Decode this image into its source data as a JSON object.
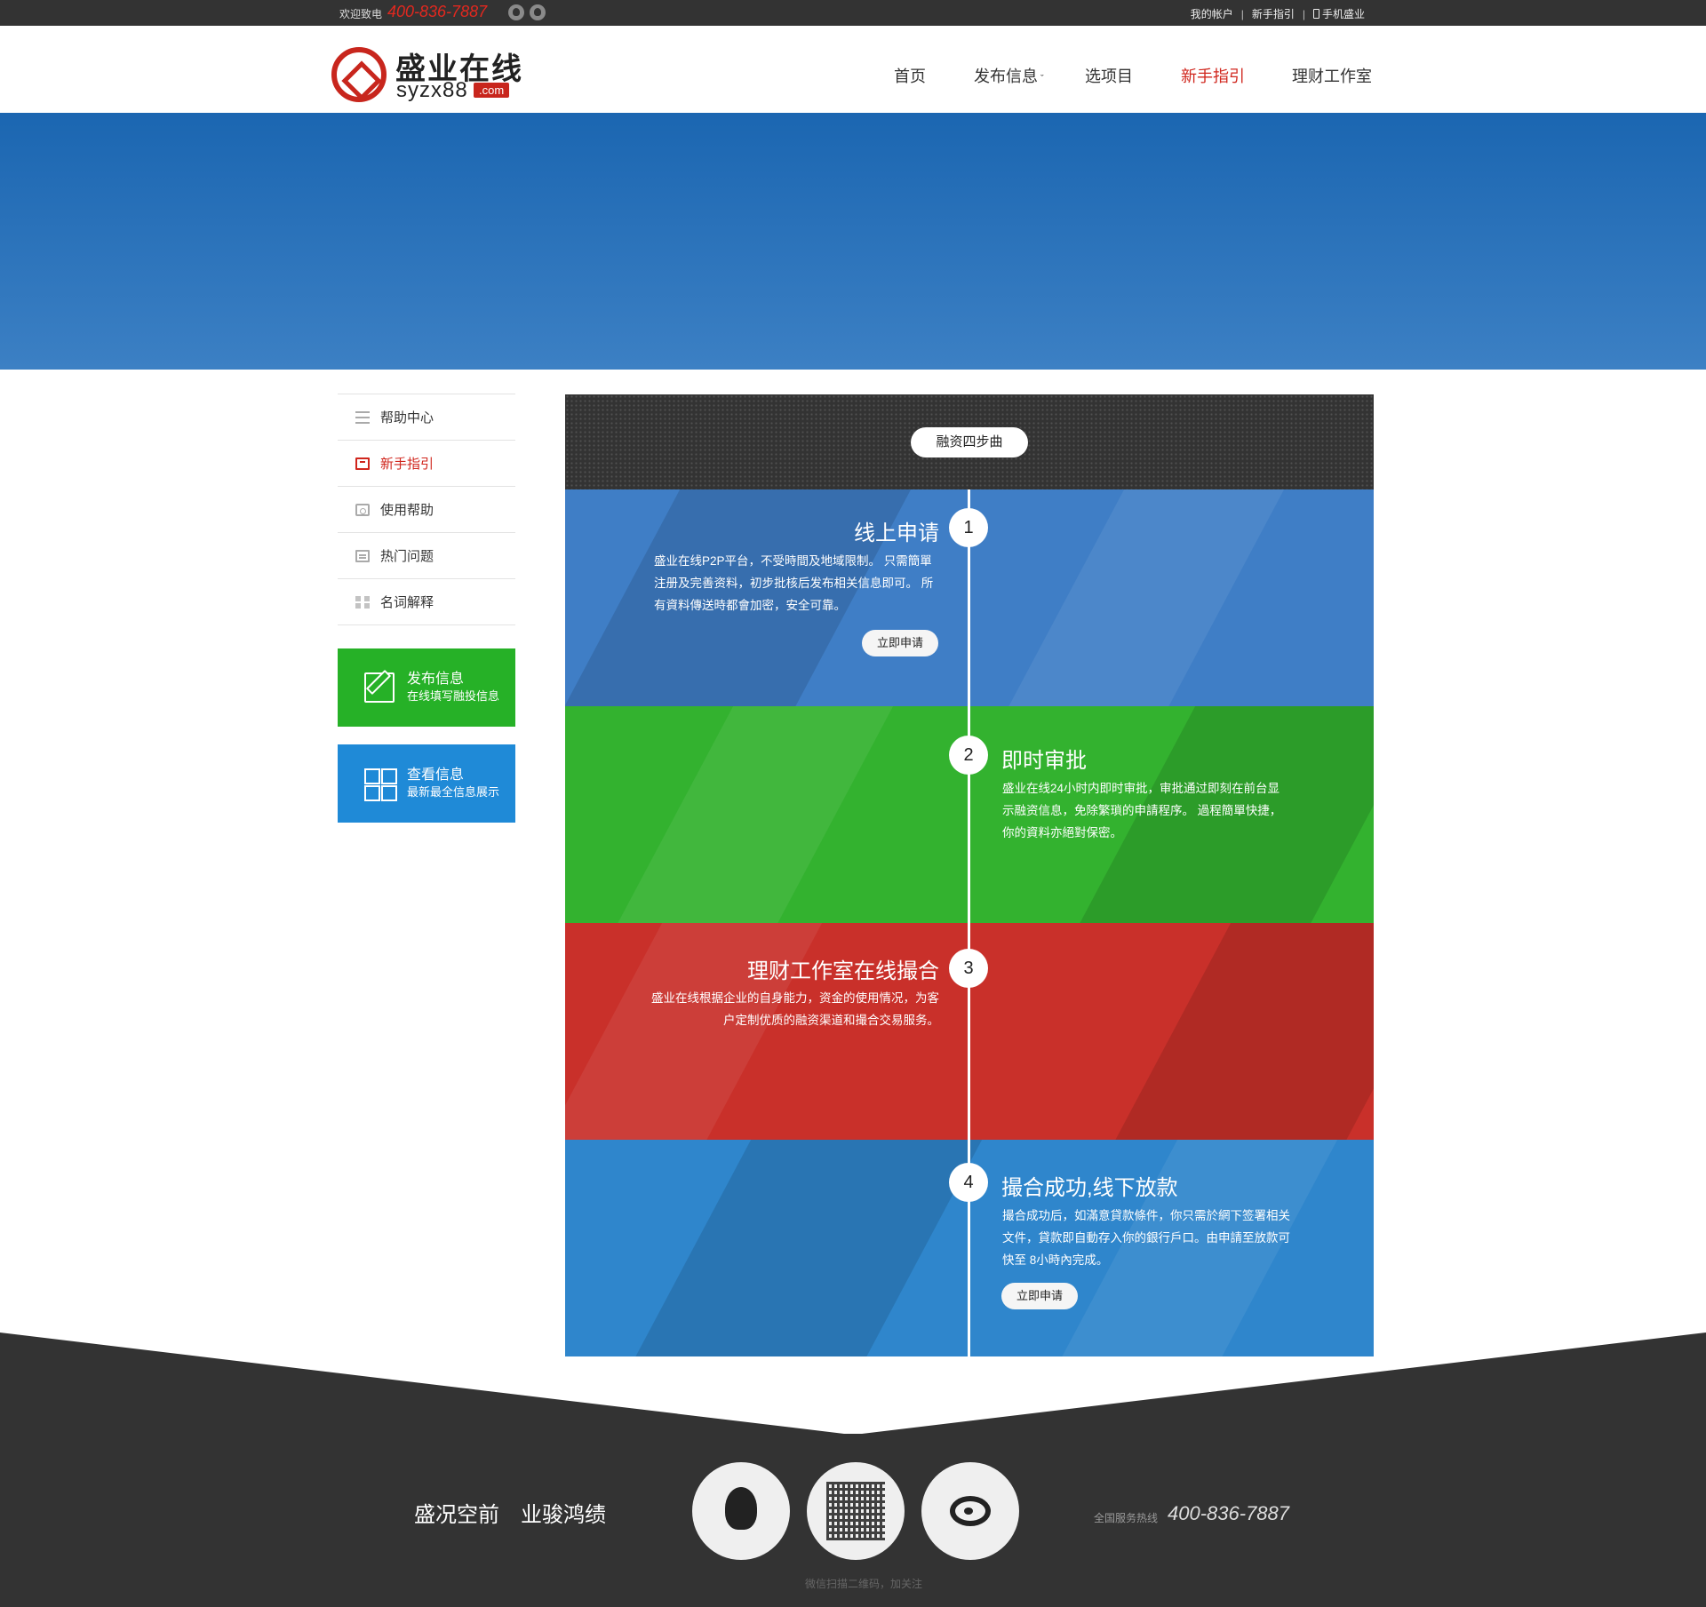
{
  "topbar": {
    "welcome": "欢迎致电",
    "phone": "400-836-7887",
    "icons": [
      "wechat-icon",
      "qq-icon"
    ],
    "links": [
      "我的帐户",
      "新手指引",
      "手机盛业"
    ],
    "separator": "|"
  },
  "header": {
    "logo_cn": "盛业在线",
    "logo_en": "syzx88",
    "logo_com": ".com",
    "nav": [
      "首页",
      "发布信息",
      "选项目",
      "新手指引",
      "理财工作室"
    ],
    "nav_active": "新手指引",
    "chevron": "ˇ"
  },
  "sidebar": {
    "items": [
      {
        "label": "帮助中心",
        "icon": "menu-icon"
      },
      {
        "label": "新手指引",
        "icon": "guide-icon",
        "active": true
      },
      {
        "label": "使用帮助",
        "icon": "help-icon"
      },
      {
        "label": "热门问题",
        "icon": "faq-icon"
      },
      {
        "label": "名词解释",
        "icon": "glossary-icon"
      }
    ],
    "publish": {
      "title": "发布信息",
      "subtitle": "在线填写融投信息",
      "icon": "pen-icon"
    },
    "view": {
      "title": "查看信息",
      "subtitle": "最新最全信息展示",
      "icon": "grid-icon"
    }
  },
  "panel": {
    "title": "融资四步曲",
    "steps": [
      {
        "num": "1",
        "title": "线上申请",
        "desc": [
          "盛业在线P2P平台，不受時間及地域限制。 只需簡單",
          "注册及完善资料，初步批核后发布相关信息即可。 所",
          "有資料傳送時都會加密，安全可靠。"
        ],
        "button": "立即申请"
      },
      {
        "num": "2",
        "title": "即时审批",
        "desc": [
          "盛业在线24小时内即时审批，审批通过即刻在前台显",
          "示融资信息，免除繁瑣的申請程序。 過程簡單快捷，",
          "你的資料亦絕對保密。"
        ]
      },
      {
        "num": "3",
        "title": "理财工作室在线撮合",
        "desc": [
          "盛业在线根据企业的自身能力，资金的使用情况，为客",
          "户定制优质的融资渠道和撮合交易服务。"
        ]
      },
      {
        "num": "4",
        "title": "撮合成功,线下放款",
        "desc": [
          "撮合成功后，如滿意貸款條件，你只需於網下签署相关",
          "文件，貸款即自動存入你的銀行戶口。由申請至放款可",
          "快至 8小時內完成。"
        ],
        "button": "立即申请"
      }
    ],
    "colors": {
      "step1": "#3f7ec6",
      "step2": "#33b22f",
      "step3": "#c9302a",
      "step4": "#2f86cc"
    }
  },
  "footer": {
    "slogan": [
      "盛况空前",
      "业骏鸿绩"
    ],
    "icons": [
      "qq-icon",
      "qrcode-icon",
      "weibo-icon"
    ],
    "qr_caption": "微信扫描二维码，加关注",
    "hotline_label": "全国服务热线",
    "hotline": "400-836-7887"
  }
}
